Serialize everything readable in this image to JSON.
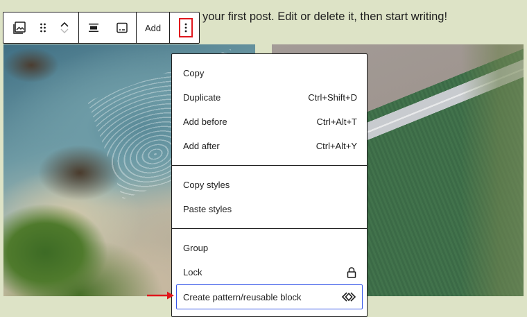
{
  "paragraph": {
    "text": "your first post. Edit or delete it, then start writing!"
  },
  "toolbar": {
    "block_type_icon": "gallery-icon",
    "drag_icon": "drag-handle-icon",
    "move_up_icon": "chevron-up-icon",
    "move_down_icon": "chevron-down-icon",
    "align_icon": "align-center-icon",
    "caption_icon": "caption-icon",
    "add_label": "Add",
    "more_icon": "more-vertical-icon"
  },
  "menu": {
    "sections": [
      {
        "items": [
          {
            "label": "Copy",
            "shortcut": ""
          },
          {
            "label": "Duplicate",
            "shortcut": "Ctrl+Shift+D"
          },
          {
            "label": "Add before",
            "shortcut": "Ctrl+Alt+T"
          },
          {
            "label": "Add after",
            "shortcut": "Ctrl+Alt+Y"
          }
        ]
      },
      {
        "items": [
          {
            "label": "Copy styles",
            "shortcut": ""
          },
          {
            "label": "Paste styles",
            "shortcut": ""
          }
        ]
      },
      {
        "items": [
          {
            "label": "Group",
            "shortcut": ""
          },
          {
            "label": "Lock",
            "shortcut": "",
            "icon": "lock-icon"
          },
          {
            "label": "Create pattern/reusable block",
            "shortcut": "",
            "icon": "symbol-icon"
          }
        ]
      }
    ]
  },
  "colors": {
    "highlight_box": "#e0161c",
    "focus_ring": "#3858e9",
    "arrow": "#e0161c",
    "background": "#dde3c6"
  }
}
